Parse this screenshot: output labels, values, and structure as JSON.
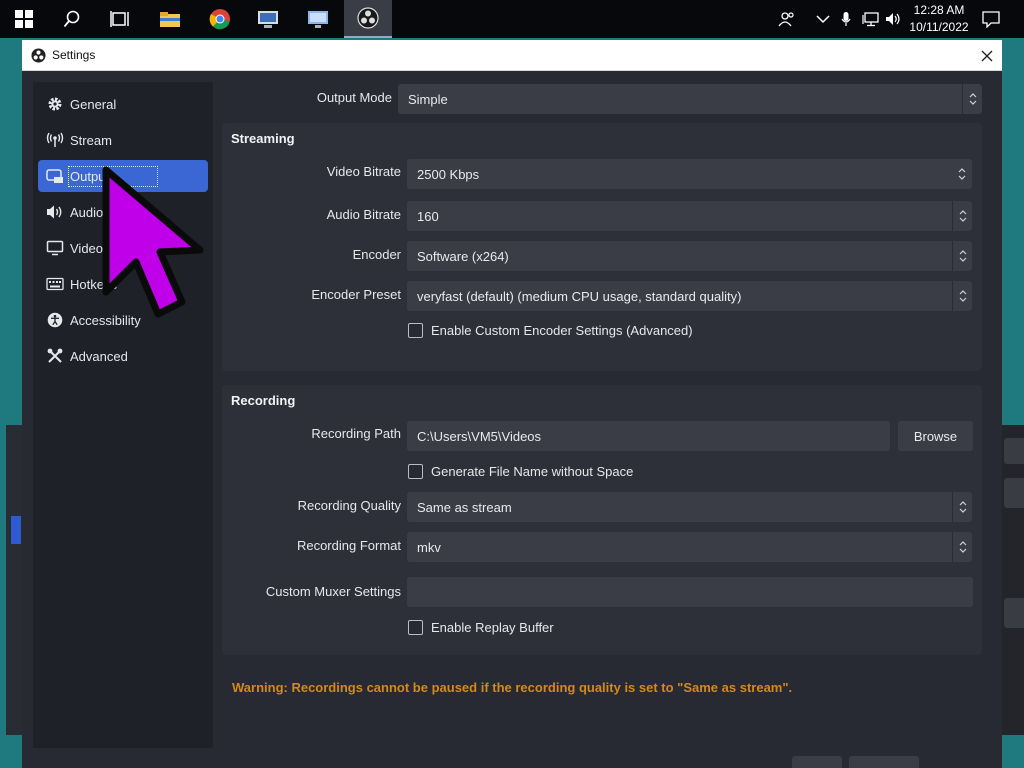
{
  "taskbar": {
    "icons": [
      "windows-start-icon",
      "search-icon",
      "task-view-icon",
      "file-explorer-icon",
      "chrome-icon",
      "network-app-icon",
      "remote-desktop-icon",
      "obs-icon"
    ],
    "tray_icons": [
      "people-icon",
      "chevron-up-icon",
      "microphone-icon",
      "network-icon",
      "volume-icon"
    ],
    "time": "12:28 AM",
    "date": "10/11/2022"
  },
  "window": {
    "title": "Settings",
    "close_glyph": "✕"
  },
  "sidebar": {
    "items": [
      {
        "label": "General",
        "icon": "gear-icon"
      },
      {
        "label": "Stream",
        "icon": "broadcast-icon"
      },
      {
        "label": "Output",
        "icon": "output-icon",
        "selected": true
      },
      {
        "label": "Audio",
        "icon": "speaker-icon"
      },
      {
        "label": "Video",
        "icon": "monitor-icon"
      },
      {
        "label": "Hotkeys",
        "icon": "keyboard-icon"
      },
      {
        "label": "Accessibility",
        "icon": "accessibility-icon"
      },
      {
        "label": "Advanced",
        "icon": "tools-icon"
      }
    ]
  },
  "output": {
    "mode_label": "Output Mode",
    "mode_value": "Simple",
    "streaming": {
      "title": "Streaming",
      "video_bitrate_label": "Video Bitrate",
      "video_bitrate_value": "2500 Kbps",
      "audio_bitrate_label": "Audio Bitrate",
      "audio_bitrate_value": "160",
      "encoder_label": "Encoder",
      "encoder_value": "Software (x264)",
      "preset_label": "Encoder Preset",
      "preset_value": "veryfast (default) (medium CPU usage, standard quality)",
      "custom_encoder_label": "Enable Custom Encoder Settings (Advanced)",
      "custom_encoder_checked": false
    },
    "recording": {
      "title": "Recording",
      "path_label": "Recording Path",
      "path_value": "C:\\Users\\VM5\\Videos",
      "browse_label": "Browse",
      "no_space_label": "Generate File Name without Space",
      "no_space_checked": false,
      "quality_label": "Recording Quality",
      "quality_value": "Same as stream",
      "format_label": "Recording Format",
      "format_value": "mkv",
      "muxer_label": "Custom Muxer Settings",
      "muxer_value": "",
      "replay_label": "Enable Replay Buffer",
      "replay_checked": false
    },
    "warning": "Warning: Recordings cannot be paused if the recording quality is set to \"Same as stream\"."
  },
  "colors": {
    "window_bg": "#272a33",
    "group_bg": "#2d3039",
    "input_bg": "#3a3d46",
    "selected": "#3b67d4",
    "warning": "#d4891a",
    "cursor": "#c000e8"
  }
}
